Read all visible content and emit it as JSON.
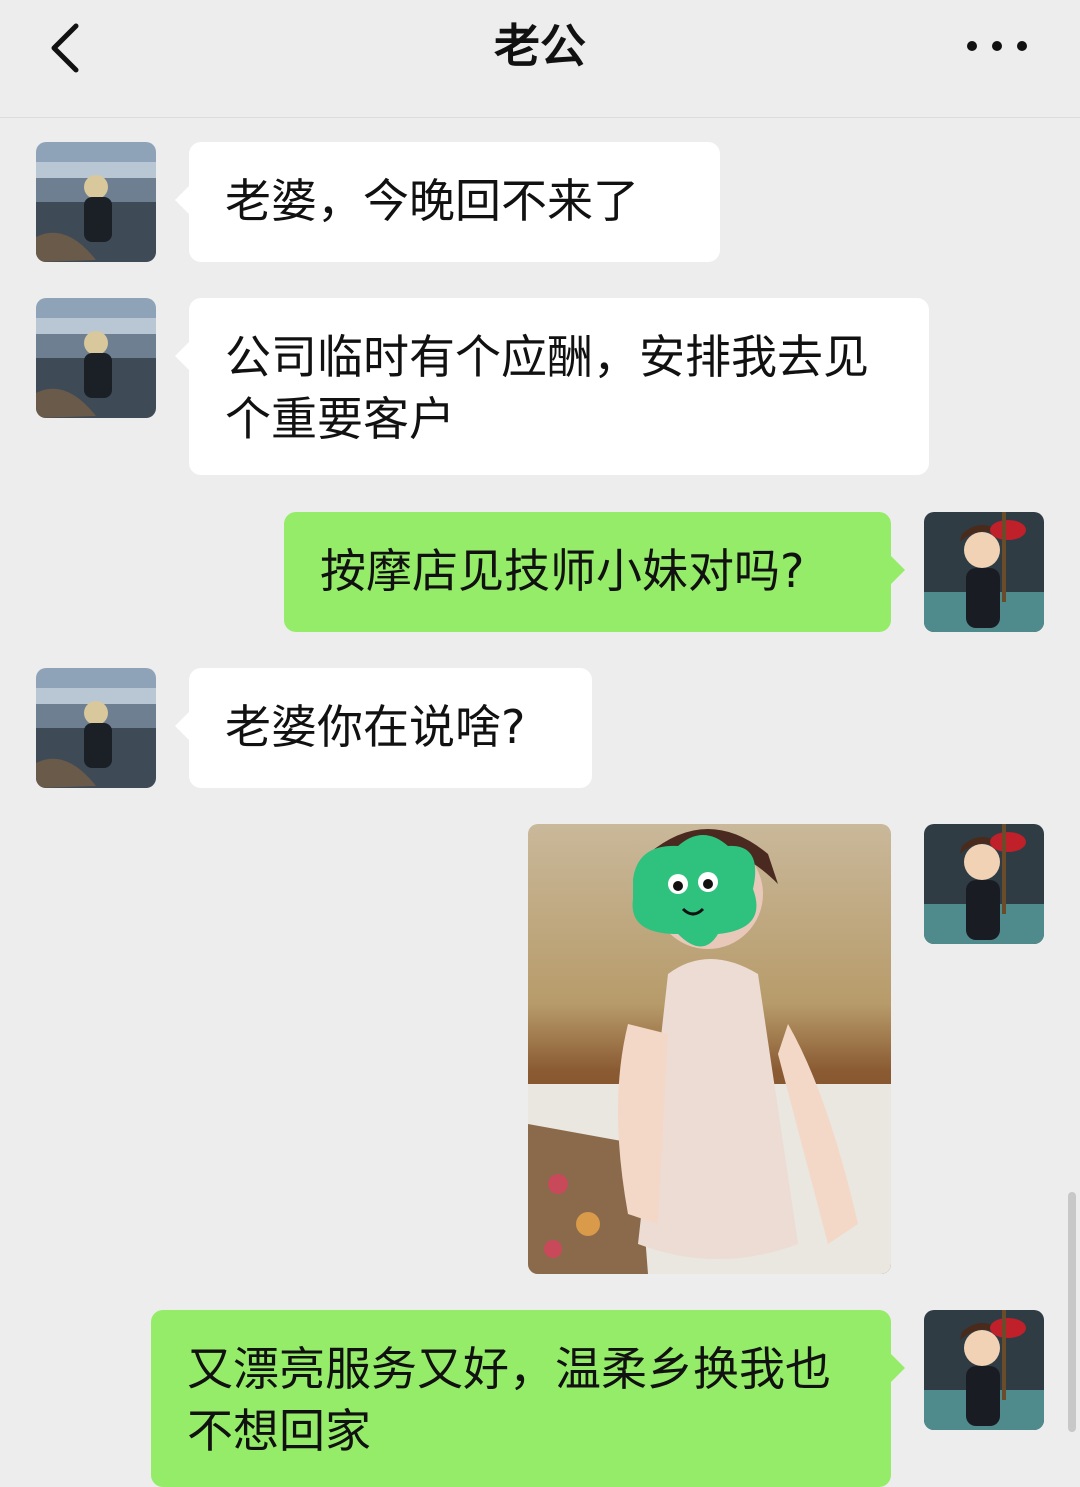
{
  "header": {
    "title": "老公",
    "back_icon": "chevron-left-icon",
    "more_icon": "more-dots-icon"
  },
  "messages": [
    {
      "side": "in",
      "type": "text",
      "text": "老婆，今晚回不来了"
    },
    {
      "side": "in",
      "type": "text",
      "text": "公司临时有个应酬，安排我去见个重要客户"
    },
    {
      "side": "out",
      "type": "text",
      "text": "按摩店见技师小妹对吗?"
    },
    {
      "side": "in",
      "type": "text",
      "text": "老婆你在说啥?"
    },
    {
      "side": "out",
      "type": "image",
      "text": ""
    },
    {
      "side": "out",
      "type": "text",
      "text": "又漂亮服务又好，温柔乡换我也不想回家"
    }
  ],
  "colors": {
    "background": "#ededed",
    "incoming_bubble": "#ffffff",
    "outgoing_bubble": "#95ec69"
  }
}
